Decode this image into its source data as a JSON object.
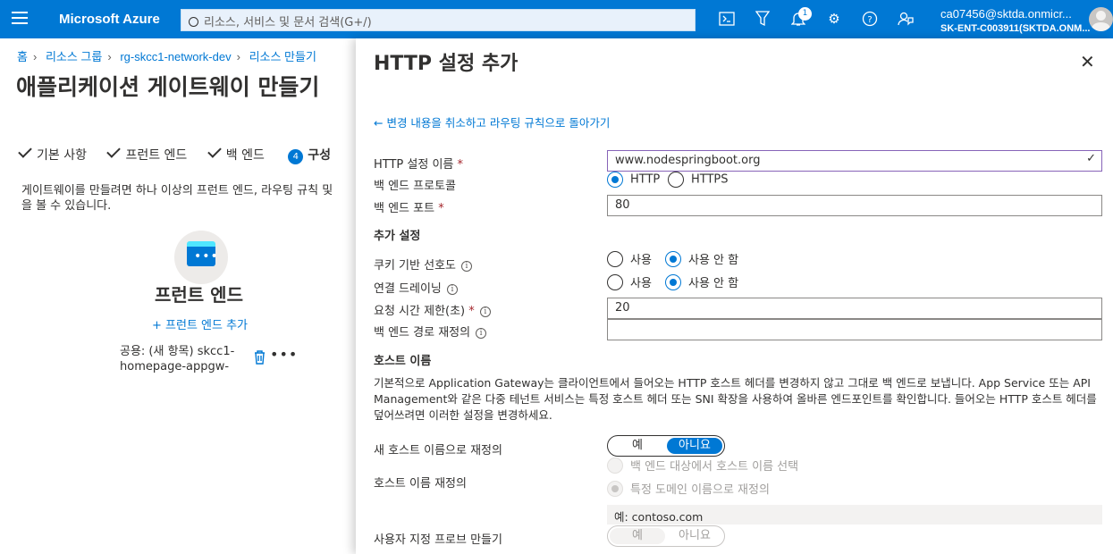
{
  "topbar": {
    "brand": "Microsoft Azure",
    "search_placeholder": "리소스, 서비스 및 문서 검색(G+/)",
    "notification_count": "1",
    "user_name": "ca07456@sktda.onmicr...",
    "user_tenant": "SK-ENT-C003911(SKTDA.ONM..."
  },
  "breadcrumb": [
    "홈",
    "리소스 그룹",
    "rg-skcc1-network-dev",
    "리소스 만들기"
  ],
  "page": {
    "title": "애플리케이션 게이트웨이 만들기",
    "tabs": {
      "basics": "기본 사항",
      "frontends": "프런트 엔드",
      "backends": "백 엔드",
      "config_num": "4",
      "config": "구성"
    },
    "description_l1": "게이트웨이를 만들려면 하나 이상의 프런트 엔드, 라우팅 규칙 및",
    "description_l2": "을 볼 수 있습니다.",
    "frontend_title": "프런트 엔드",
    "frontend_add": "+ 프런트 엔드 추가",
    "frontend_item_l1": "공용: (새 항목) skcc1-",
    "frontend_item_l2": "homepage-appgw-pip"
  },
  "panel": {
    "title": "HTTP 설정 추가",
    "back_link": "← 변경 내용을 취소하고 라우팅 규칙으로 돌아가기",
    "http_setting_name_label": "HTTP 설정 이름",
    "http_setting_name_value": "www.nodespringboot.org",
    "backend_protocol_label": "백 엔드 프로토콜",
    "protocol_http": "HTTP",
    "protocol_https": "HTTPS",
    "backend_port_label": "백 엔드 포트",
    "backend_port_value": "80",
    "additional_settings": "추가 설정",
    "cookie_affinity_label": "쿠키 기반 선호도",
    "connection_draining_label": "연결 드레이닝",
    "enable": "사용",
    "disable": "사용 안 함",
    "request_timeout_label": "요청 시간 제한(초)",
    "request_timeout_value": "20",
    "override_path_label": "백 엔드 경로 재정의",
    "override_path_value": "",
    "host_name_section": "호스트 이름",
    "host_name_desc": "기본적으로 Application Gateway는 클라이언트에서 들어오는 HTTP 호스트 헤더를 변경하지 않고 그대로 백 엔드로 보냅니다. App Service 또는 API Management와 같은 다중 테넌트 서비스는 특정 호스트 헤더 또는 SNI 확장을 사용하여 올바른 엔드포인트를 확인합니다. 들어오는 HTTP 호스트 헤더를 덮어쓰려면 이러한 설정을 변경하세요.",
    "override_new_host_label": "새 호스트 이름으로 재정의",
    "yes": "예",
    "no": "아니요",
    "pick_host_from_backend": "백 엔드 대상에서 호스트 이름 선택",
    "host_override_label": "호스트 이름 재정의",
    "override_specific_domain": "특정 도메인 이름으로 재정의",
    "host_example": "예: contoso.com",
    "custom_probe_label": "사용자 지정 프로브 만들기"
  }
}
